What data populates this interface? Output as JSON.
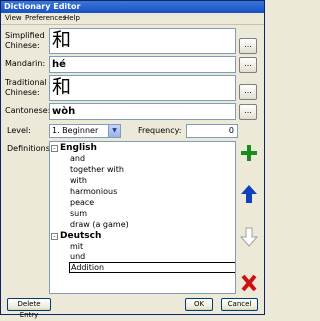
{
  "window": {
    "title": "Dictionary Editor"
  },
  "menu": [
    "View",
    "Preferences",
    "Help"
  ],
  "fields": {
    "simplified": {
      "label_line1": "Simplified",
      "label_line2": "Chinese:",
      "value": "和",
      "button": "..."
    },
    "mandarin": {
      "label": "Mandarin:",
      "value": "hé",
      "button": "..."
    },
    "traditional": {
      "label_line1": "Traditional",
      "label_line2": "Chinese:",
      "value": "和",
      "button": "..."
    },
    "cantonese": {
      "label": "Cantonese:",
      "value": "wòh",
      "button": "..."
    }
  },
  "level": {
    "label": "Level:",
    "value": "1. Beginner"
  },
  "frequency": {
    "label": "Frequency:",
    "value": "0"
  },
  "definitions": {
    "label": "Definitions:",
    "groups": [
      {
        "language": "English",
        "expander": "-",
        "items": [
          "and",
          "together with",
          "with",
          "harmonious",
          "peace",
          "sum",
          "draw (a game)"
        ]
      },
      {
        "language": "Deutsch",
        "expander": "-",
        "items": [
          "mit",
          "und"
        ]
      }
    ],
    "editing": "Addition"
  },
  "side_buttons": [
    "add-icon",
    "move-up-icon",
    "move-down-icon",
    "delete-icon"
  ],
  "colors": {
    "add": "#1a8c1a",
    "up": "#1040c0",
    "delete": "#d01010",
    "titlebar": "#1550c7"
  },
  "buttons": {
    "delete_entry": "Delete Entry",
    "ok": "OK",
    "cancel": "Cancel"
  }
}
